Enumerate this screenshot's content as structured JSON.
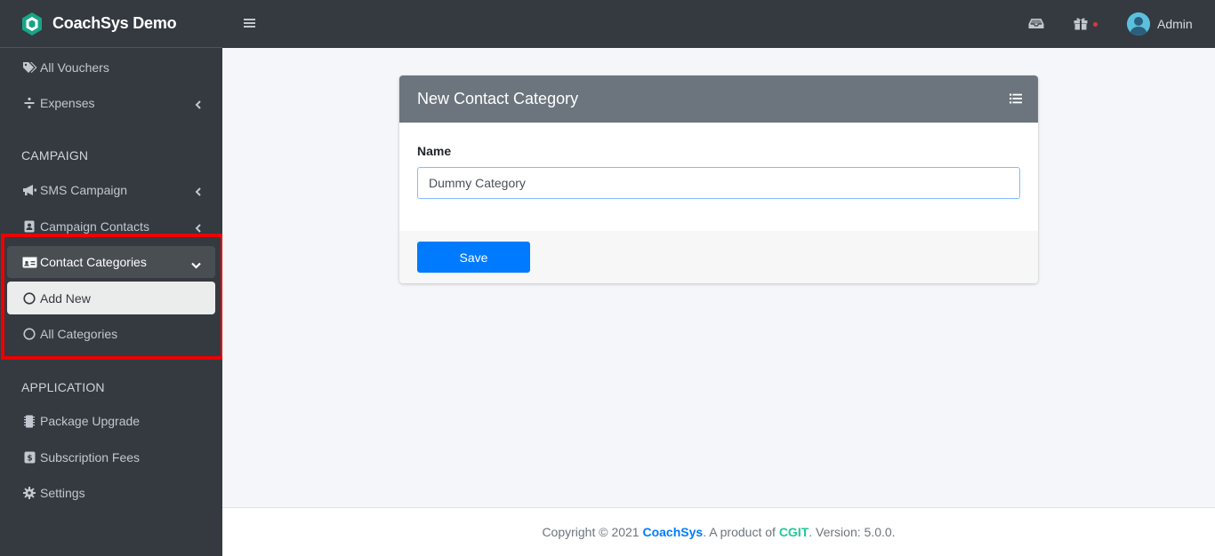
{
  "brand": {
    "name": "CoachSys Demo"
  },
  "sidebar": {
    "items": [
      {
        "label": "All Vouchers",
        "icon": "tags-icon"
      },
      {
        "label": "Expenses",
        "icon": "divide-icon"
      },
      {
        "label": "SMS Campaign",
        "icon": "bullhorn-icon"
      },
      {
        "label": "Campaign Contacts",
        "icon": "address-book-icon"
      },
      {
        "label": "Contact Categories",
        "icon": "id-card-icon"
      },
      {
        "label": "Add New",
        "icon": "circle-icon"
      },
      {
        "label": "All Categories",
        "icon": "circle-icon"
      },
      {
        "label": "Package Upgrade",
        "icon": "microchip-icon"
      },
      {
        "label": "Subscription Fees",
        "icon": "money-icon"
      },
      {
        "label": "Settings",
        "icon": "gear-icon"
      }
    ],
    "headers": {
      "campaign": "CAMPAIGN",
      "application": "APPLICATION"
    }
  },
  "topbar": {
    "user_name": "Admin"
  },
  "form": {
    "title": "New Contact Category",
    "name_label": "Name",
    "name_value": "Dummy Category",
    "save_label": "Save"
  },
  "footer": {
    "prefix": "Copyright © 2021 ",
    "brand": "CoachSys",
    "middle": ". A product of ",
    "company": "CGIT",
    "suffix": ". Version: 5.0.0."
  },
  "colors": {
    "sidebar_bg": "#343a40",
    "primary": "#007bff",
    "card_header": "#6c757d",
    "highlight": "#ee0000",
    "brand_green": "#20c997"
  }
}
